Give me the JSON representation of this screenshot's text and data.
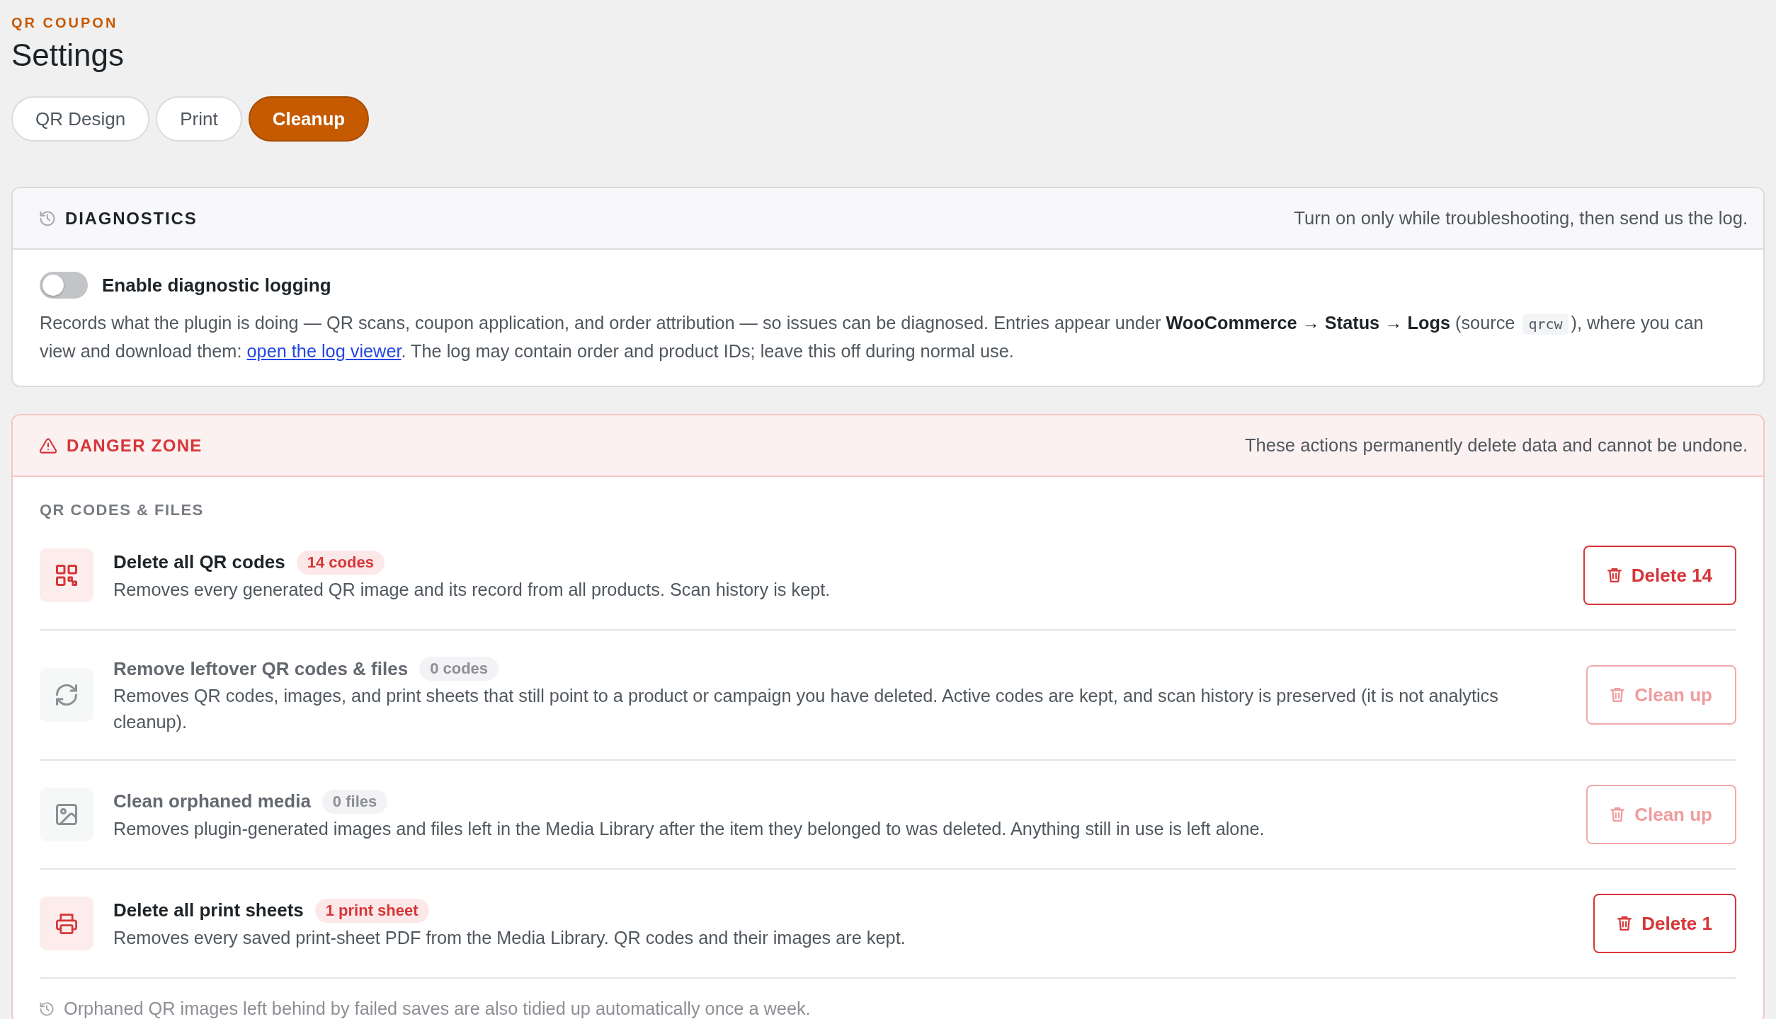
{
  "header": {
    "kicker": "QR COUPON",
    "title": "Settings"
  },
  "tabs": [
    {
      "label": "QR Design",
      "selected": false
    },
    {
      "label": "Print",
      "selected": false
    },
    {
      "label": "Cleanup",
      "selected": true
    }
  ],
  "diagnostics": {
    "title": "DIAGNOSTICS",
    "hint": "Turn on only while troubleshooting, then send us the log.",
    "toggle": {
      "label": "Enable diagnostic logging",
      "on": false
    },
    "description": [
      {
        "kind": "text",
        "text": "Records what the plugin is doing — QR scans, coupon application, and order attribution — so issues can be diagnosed. Entries appear under "
      },
      {
        "kind": "bold",
        "text": "WooCommerce → Status → Logs"
      },
      {
        "kind": "text",
        "text": " (source "
      },
      {
        "kind": "code",
        "text": "qrcw"
      },
      {
        "kind": "text",
        "text": "), where you can view and download them: "
      },
      {
        "kind": "link",
        "text": "open the log viewer"
      },
      {
        "kind": "text",
        "text": ". The log may contain order and product IDs; leave this off during normal use."
      }
    ]
  },
  "danger_zone": {
    "title": "DANGER ZONE",
    "hint": "These actions permanently delete data and cannot be undone.",
    "section_label": "QR CODES & FILES",
    "actions": [
      {
        "kind": "codes",
        "title": "Delete all QR codes",
        "badge": "14 codes",
        "description": "Removes every generated QR image and its record from all products. Scan history is kept.",
        "button": "Delete 14",
        "disabled": false
      },
      {
        "kind": "leftovers",
        "title": "Remove leftover QR codes & files",
        "badge": "0 codes",
        "description": "Removes QR codes, images, and print sheets that still point to a product or campaign you have deleted. Active codes are kept, and scan history is preserved (it is not analytics cleanup).",
        "button": "Clean up",
        "disabled": true
      },
      {
        "kind": "media",
        "title": "Clean orphaned media",
        "badge": "0 files",
        "description": "Removes plugin-generated images and files left in the Media Library after the item they belonged to was deleted. Anything still in use is left alone.",
        "button": "Clean up",
        "disabled": true
      },
      {
        "kind": "sheets",
        "title": "Delete all print sheets",
        "badge": "1 print sheet",
        "description": "Removes every saved print-sheet PDF from the Media Library. QR codes and their images are kept.",
        "button": "Delete 1",
        "disabled": false
      }
    ],
    "note": "Orphaned QR images left behind by failed saves are also tidied up automatically once a week."
  }
}
